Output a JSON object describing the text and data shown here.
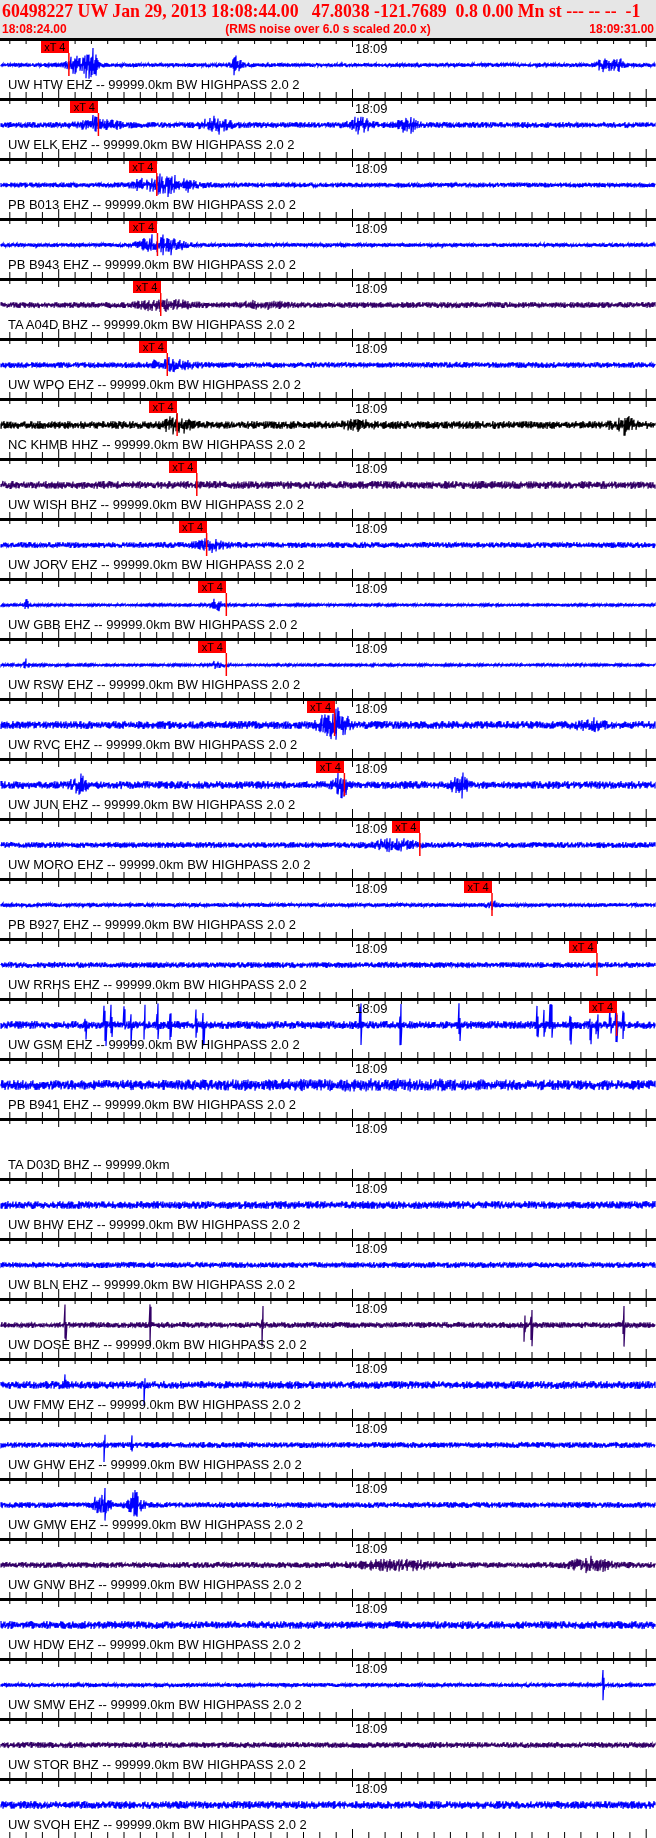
{
  "header": {
    "title": "60498227 UW Jan 29, 2013 18:08:44.00   47.8038 -121.7689  0.8 0.00 Mn st --- -- --  -1",
    "start_time": "18:08:24.00",
    "note": "(RMS noise over 6.0 s scaled 20.0 x)",
    "end_time": "18:09:31.00"
  },
  "traces": [
    {
      "label": "UW HTW EHZ -- 99999.0km BW HIGHPASS 2.0 2",
      "time_label": "18:09",
      "pick": "xT 4",
      "color": "#0000ff",
      "kind": "wave"
    },
    {
      "label": "UW ELK EHZ -- 99999.0km BW HIGHPASS 2.0 2",
      "time_label": "18:09",
      "pick": "xT 4",
      "color": "#0000ff",
      "kind": "wave"
    },
    {
      "label": "PB B013 EHZ -- 99999.0km BW HIGHPASS 2.0 2",
      "time_label": "18:09",
      "pick": "xT 4",
      "color": "#0000ff",
      "kind": "wave"
    },
    {
      "label": "PB B943 EHZ -- 99999.0km BW HIGHPASS 2.0 2",
      "time_label": "18:09",
      "pick": "xT 4",
      "color": "#0000ff",
      "kind": "wave"
    },
    {
      "label": "TA A04D BHZ -- 99999.0km BW HIGHPASS 2.0 2",
      "time_label": "18:09",
      "pick": "xT 4",
      "color": "#330066",
      "kind": "wave"
    },
    {
      "label": "UW WPO EHZ -- 99999.0km BW HIGHPASS 2.0 2",
      "time_label": "18:09",
      "pick": "xT 4",
      "color": "#0000ff",
      "kind": "wave"
    },
    {
      "label": "NC KHMB HHZ -- 99999.0km BW HIGHPASS 2.0 2",
      "time_label": "18:09",
      "pick": "xT 4",
      "color": "#000000",
      "kind": "wave"
    },
    {
      "label": "UW WISH BHZ -- 99999.0km BW HIGHPASS 2.0 2",
      "time_label": "18:09",
      "pick": "xT 4",
      "color": "#330066",
      "kind": "wave"
    },
    {
      "label": "UW JORV EHZ -- 99999.0km BW HIGHPASS 2.0 2",
      "time_label": "18:09",
      "pick": "xT 4",
      "color": "#0000ff",
      "kind": "wave"
    },
    {
      "label": "UW GBB EHZ -- 99999.0km BW HIGHPASS 2.0 2",
      "time_label": "18:09",
      "pick": "xT 4",
      "color": "#0000ff",
      "kind": "wave"
    },
    {
      "label": "UW RSW EHZ -- 99999.0km BW HIGHPASS 2.0 2",
      "time_label": "18:09",
      "pick": "xT 4",
      "color": "#0000ff",
      "kind": "wave"
    },
    {
      "label": "UW RVC EHZ -- 99999.0km BW HIGHPASS 2.0 2",
      "time_label": "18:09",
      "pick": "xT 4",
      "color": "#0000ff",
      "kind": "wave"
    },
    {
      "label": "UW JUN EHZ -- 99999.0km BW HIGHPASS 2.0 2",
      "time_label": "18:09",
      "pick": "xT 4",
      "color": "#0000ff",
      "kind": "wave"
    },
    {
      "label": "UW MORO EHZ -- 99999.0km BW HIGHPASS 2.0 2",
      "time_label": "18:09",
      "pick": "xT 4",
      "color": "#0000ff",
      "kind": "wave"
    },
    {
      "label": "PB B927 EHZ -- 99999.0km BW HIGHPASS 2.0 2",
      "time_label": "18:09",
      "pick": "xT 4",
      "color": "#0000ff",
      "kind": "wave"
    },
    {
      "label": "UW RRHS EHZ -- 99999.0km BW HIGHPASS 2.0 2",
      "time_label": "18:09",
      "pick": "xT 4",
      "color": "#0000ff",
      "kind": "wave"
    },
    {
      "label": "UW GSM EHZ -- 99999.0km BW HIGHPASS 2.0 2",
      "time_label": "18:09",
      "pick": "xT 4",
      "color": "#0000ff",
      "kind": "wave"
    },
    {
      "label": "PB B941 EHZ -- 99999.0km BW HIGHPASS 2.0 2",
      "time_label": "18:09",
      "color": "#0000ff",
      "kind": "wave"
    },
    {
      "label": "TA D03D BHZ -- 99999.0km",
      "time_label": "18:09",
      "kind": "empty"
    },
    {
      "label": "UW BHW EHZ -- 99999.0km BW HIGHPASS 2.0 2",
      "time_label": "18:09",
      "color": "#0000ff",
      "kind": "wave"
    },
    {
      "label": "UW BLN EHZ -- 99999.0km BW HIGHPASS 2.0 2",
      "time_label": "18:09",
      "color": "#0000ff",
      "kind": "wave"
    },
    {
      "label": "UW DOSE BHZ -- 99999.0km BW HIGHPASS 2.0 2",
      "time_label": "18:09",
      "color": "#330066",
      "kind": "wave"
    },
    {
      "label": "UW FMW EHZ -- 99999.0km BW HIGHPASS 2.0 2",
      "time_label": "18:09",
      "color": "#0000ff",
      "kind": "wave"
    },
    {
      "label": "UW GHW EHZ -- 99999.0km BW HIGHPASS 2.0 2",
      "time_label": "18:09",
      "color": "#0000ff",
      "kind": "wave"
    },
    {
      "label": "UW GMW EHZ -- 99999.0km BW HIGHPASS 2.0 2",
      "time_label": "18:09",
      "color": "#0000ff",
      "kind": "wave"
    },
    {
      "label": "UW GNW BHZ -- 99999.0km BW HIGHPASS 2.0 2",
      "time_label": "18:09",
      "color": "#330066",
      "kind": "wave"
    },
    {
      "label": "UW HDW EHZ -- 99999.0km BW HIGHPASS 2.0 2",
      "time_label": "18:09",
      "color": "#0000ff",
      "kind": "wave"
    },
    {
      "label": "UW SMW EHZ -- 99999.0km BW HIGHPASS 2.0 2",
      "time_label": "18:09",
      "color": "#0000ff",
      "kind": "wave"
    },
    {
      "label": "UW STOR BHZ -- 99999.0km BW HIGHPASS 2.0 2",
      "time_label": "18:09",
      "color": "#330066",
      "kind": "wave"
    },
    {
      "label": "UW SVOH EHZ -- 99999.0km BW HIGHPASS 2.0 2",
      "time_label": "18:09",
      "color": "#0000ff",
      "kind": "wave"
    }
  ]
}
